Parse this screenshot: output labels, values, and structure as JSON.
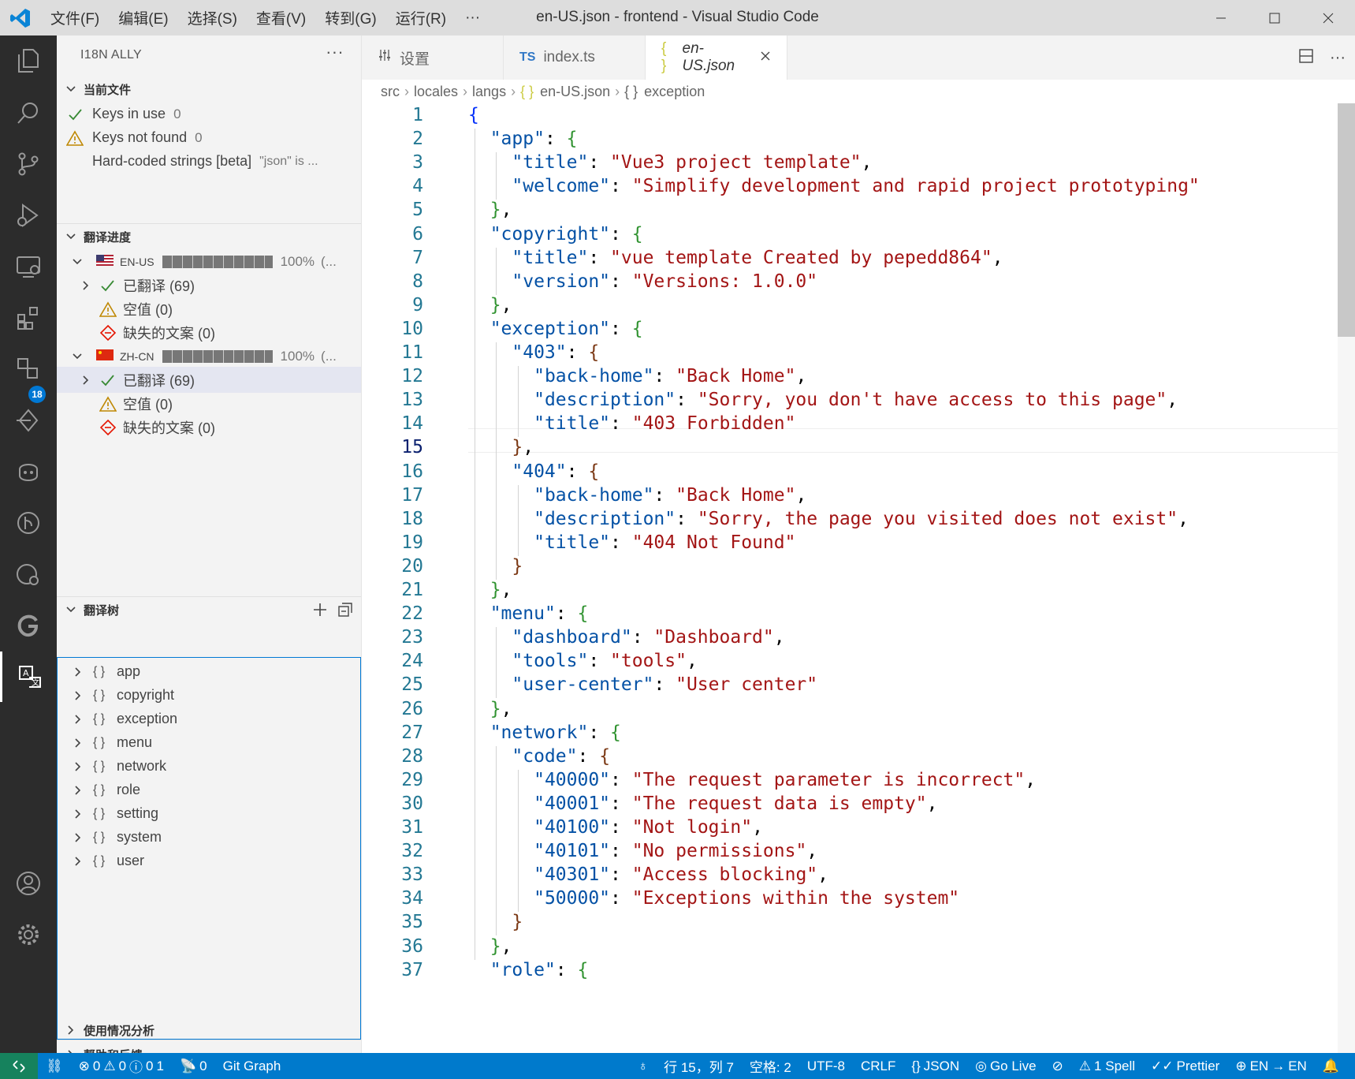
{
  "window": {
    "title": "en-US.json - frontend - Visual Studio Code",
    "menu": [
      "文件(F)",
      "编辑(E)",
      "选择(S)",
      "查看(V)",
      "转到(G)",
      "运行(R)",
      "···"
    ]
  },
  "activity_bar": {
    "icons": [
      "files-icon",
      "search-icon",
      "source-control-icon",
      "run-debug-icon",
      "remote-explorer-icon",
      "extensions-icon",
      "panel-icon",
      "timeline-icon",
      "copilot-icon",
      "git-graph-icon",
      "git-lens-icon",
      "gitlens-g-icon",
      "i18n-icon",
      "account-icon",
      "gear-icon"
    ],
    "extensions_badge": "18"
  },
  "sidebar": {
    "title": "I18N ALLY",
    "current_file": {
      "title": "当前文件",
      "keys_in_use": "Keys in use",
      "keys_in_use_count": "0",
      "keys_not_found": "Keys not found",
      "keys_not_found_count": "0",
      "hardcoded": "Hard-coded strings [beta]",
      "hardcoded_desc": "\"json\" is ..."
    },
    "progress": {
      "title": "翻译进度",
      "locales": [
        {
          "code": "EN-US",
          "percent": "100%",
          "extra": "(...",
          "translated": "已翻译 (69)",
          "empty": "空值 (0)",
          "missing": "缺失的文案 (0)"
        },
        {
          "code": "ZH-CN",
          "percent": "100%",
          "extra": "(...",
          "translated": "已翻译 (69)",
          "empty": "空值 (0)",
          "missing": "缺失的文案 (0)"
        }
      ]
    },
    "tree": {
      "title": "翻译树",
      "items": [
        "app",
        "copyright",
        "exception",
        "menu",
        "network",
        "role",
        "setting",
        "system",
        "user"
      ]
    },
    "usage": "使用情况分析",
    "help": "帮助和反馈"
  },
  "tabs": [
    {
      "icon": "settings",
      "label": "设置"
    },
    {
      "icon": "TS",
      "label": "index.ts"
    },
    {
      "icon": "{ }",
      "label": "en-US.json"
    }
  ],
  "breadcrumb": [
    "src",
    "locales",
    "langs",
    "en-US.json",
    "exception"
  ],
  "editor": {
    "current_line": "15",
    "lines": [
      {
        "n": "1",
        "parts": [
          [
            "b1",
            "{"
          ]
        ]
      },
      {
        "n": "2",
        "parts": [
          [
            "p",
            "  "
          ],
          [
            "k",
            "\"app\""
          ],
          [
            "p",
            ": "
          ],
          [
            "b2",
            "{"
          ]
        ]
      },
      {
        "n": "3",
        "parts": [
          [
            "p",
            "    "
          ],
          [
            "k",
            "\"title\""
          ],
          [
            "p",
            ": "
          ],
          [
            "s",
            "\"Vue3 project template\""
          ],
          [
            "p",
            ","
          ]
        ]
      },
      {
        "n": "4",
        "parts": [
          [
            "p",
            "    "
          ],
          [
            "k",
            "\"welcome\""
          ],
          [
            "p",
            ": "
          ],
          [
            "s",
            "\"Simplify development and rapid project prototyping\""
          ]
        ]
      },
      {
        "n": "5",
        "parts": [
          [
            "p",
            "  "
          ],
          [
            "b2",
            "}"
          ],
          [
            "p",
            ","
          ]
        ]
      },
      {
        "n": "6",
        "parts": [
          [
            "p",
            "  "
          ],
          [
            "k",
            "\"copyright\""
          ],
          [
            "p",
            ": "
          ],
          [
            "b2",
            "{"
          ]
        ]
      },
      {
        "n": "7",
        "parts": [
          [
            "p",
            "    "
          ],
          [
            "k",
            "\"title\""
          ],
          [
            "p",
            ": "
          ],
          [
            "s",
            "\"vue template Created by pepedd864\""
          ],
          [
            "p",
            ","
          ]
        ]
      },
      {
        "n": "8",
        "parts": [
          [
            "p",
            "    "
          ],
          [
            "k",
            "\"version\""
          ],
          [
            "p",
            ": "
          ],
          [
            "s",
            "\"Versions: 1.0.0\""
          ]
        ]
      },
      {
        "n": "9",
        "parts": [
          [
            "p",
            "  "
          ],
          [
            "b2",
            "}"
          ],
          [
            "p",
            ","
          ]
        ]
      },
      {
        "n": "10",
        "parts": [
          [
            "p",
            "  "
          ],
          [
            "k",
            "\"exception\""
          ],
          [
            "p",
            ": "
          ],
          [
            "b2",
            "{"
          ]
        ]
      },
      {
        "n": "11",
        "parts": [
          [
            "p",
            "    "
          ],
          [
            "k",
            "\"403\""
          ],
          [
            "p",
            ": "
          ],
          [
            "b3",
            "{"
          ]
        ]
      },
      {
        "n": "12",
        "parts": [
          [
            "p",
            "      "
          ],
          [
            "k",
            "\"back-home\""
          ],
          [
            "p",
            ": "
          ],
          [
            "s",
            "\"Back Home\""
          ],
          [
            "p",
            ","
          ]
        ]
      },
      {
        "n": "13",
        "parts": [
          [
            "p",
            "      "
          ],
          [
            "k",
            "\"description\""
          ],
          [
            "p",
            ": "
          ],
          [
            "s",
            "\"Sorry, you don't have access to this page\""
          ],
          [
            "p",
            ","
          ]
        ]
      },
      {
        "n": "14",
        "parts": [
          [
            "p",
            "      "
          ],
          [
            "k",
            "\"title\""
          ],
          [
            "p",
            ": "
          ],
          [
            "s",
            "\"403 Forbidden\""
          ]
        ]
      },
      {
        "n": "15",
        "parts": [
          [
            "p",
            "    "
          ],
          [
            "b3",
            "}"
          ],
          [
            "p",
            ","
          ]
        ]
      },
      {
        "n": "16",
        "parts": [
          [
            "p",
            "    "
          ],
          [
            "k",
            "\"404\""
          ],
          [
            "p",
            ": "
          ],
          [
            "b3",
            "{"
          ]
        ]
      },
      {
        "n": "17",
        "parts": [
          [
            "p",
            "      "
          ],
          [
            "k",
            "\"back-home\""
          ],
          [
            "p",
            ": "
          ],
          [
            "s",
            "\"Back Home\""
          ],
          [
            "p",
            ","
          ]
        ]
      },
      {
        "n": "18",
        "parts": [
          [
            "p",
            "      "
          ],
          [
            "k",
            "\"description\""
          ],
          [
            "p",
            ": "
          ],
          [
            "s",
            "\"Sorry, the page you visited does not exist\""
          ],
          [
            "p",
            ","
          ]
        ]
      },
      {
        "n": "19",
        "parts": [
          [
            "p",
            "      "
          ],
          [
            "k",
            "\"title\""
          ],
          [
            "p",
            ": "
          ],
          [
            "s",
            "\"404 Not Found\""
          ]
        ]
      },
      {
        "n": "20",
        "parts": [
          [
            "p",
            "    "
          ],
          [
            "b3",
            "}"
          ]
        ]
      },
      {
        "n": "21",
        "parts": [
          [
            "p",
            "  "
          ],
          [
            "b2",
            "}"
          ],
          [
            "p",
            ","
          ]
        ]
      },
      {
        "n": "22",
        "parts": [
          [
            "p",
            "  "
          ],
          [
            "k",
            "\"menu\""
          ],
          [
            "p",
            ": "
          ],
          [
            "b2",
            "{"
          ]
        ]
      },
      {
        "n": "23",
        "parts": [
          [
            "p",
            "    "
          ],
          [
            "k",
            "\"dashboard\""
          ],
          [
            "p",
            ": "
          ],
          [
            "s",
            "\"Dashboard\""
          ],
          [
            "p",
            ","
          ]
        ]
      },
      {
        "n": "24",
        "parts": [
          [
            "p",
            "    "
          ],
          [
            "k",
            "\"tools\""
          ],
          [
            "p",
            ": "
          ],
          [
            "s",
            "\"tools\""
          ],
          [
            "p",
            ","
          ]
        ]
      },
      {
        "n": "25",
        "parts": [
          [
            "p",
            "    "
          ],
          [
            "k",
            "\"user-center\""
          ],
          [
            "p",
            ": "
          ],
          [
            "s",
            "\"User center\""
          ]
        ]
      },
      {
        "n": "26",
        "parts": [
          [
            "p",
            "  "
          ],
          [
            "b2",
            "}"
          ],
          [
            "p",
            ","
          ]
        ]
      },
      {
        "n": "27",
        "parts": [
          [
            "p",
            "  "
          ],
          [
            "k",
            "\"network\""
          ],
          [
            "p",
            ": "
          ],
          [
            "b2",
            "{"
          ]
        ]
      },
      {
        "n": "28",
        "parts": [
          [
            "p",
            "    "
          ],
          [
            "k",
            "\"code\""
          ],
          [
            "p",
            ": "
          ],
          [
            "b3",
            "{"
          ]
        ]
      },
      {
        "n": "29",
        "parts": [
          [
            "p",
            "      "
          ],
          [
            "k",
            "\"40000\""
          ],
          [
            "p",
            ": "
          ],
          [
            "s",
            "\"The request parameter is incorrect\""
          ],
          [
            "p",
            ","
          ]
        ]
      },
      {
        "n": "30",
        "parts": [
          [
            "p",
            "      "
          ],
          [
            "k",
            "\"40001\""
          ],
          [
            "p",
            ": "
          ],
          [
            "s",
            "\"The request data is empty\""
          ],
          [
            "p",
            ","
          ]
        ]
      },
      {
        "n": "31",
        "parts": [
          [
            "p",
            "      "
          ],
          [
            "k",
            "\"40100\""
          ],
          [
            "p",
            ": "
          ],
          [
            "s",
            "\"Not login\""
          ],
          [
            "p",
            ","
          ]
        ]
      },
      {
        "n": "32",
        "parts": [
          [
            "p",
            "      "
          ],
          [
            "k",
            "\"40101\""
          ],
          [
            "p",
            ": "
          ],
          [
            "s",
            "\"No permissions\""
          ],
          [
            "p",
            ","
          ]
        ]
      },
      {
        "n": "33",
        "parts": [
          [
            "p",
            "      "
          ],
          [
            "k",
            "\"40301\""
          ],
          [
            "p",
            ": "
          ],
          [
            "s",
            "\"Access blocking\""
          ],
          [
            "p",
            ","
          ]
        ]
      },
      {
        "n": "34",
        "parts": [
          [
            "p",
            "      "
          ],
          [
            "k",
            "\"50000\""
          ],
          [
            "p",
            ": "
          ],
          [
            "s",
            "\"Exceptions within the system\""
          ]
        ]
      },
      {
        "n": "35",
        "parts": [
          [
            "p",
            "    "
          ],
          [
            "b3",
            "}"
          ]
        ]
      },
      {
        "n": "36",
        "parts": [
          [
            "p",
            "  "
          ],
          [
            "b2",
            "}"
          ],
          [
            "p",
            ","
          ]
        ]
      },
      {
        "n": "37",
        "parts": [
          [
            "p",
            "  "
          ],
          [
            "k",
            "\"role\""
          ],
          [
            "p",
            ": "
          ],
          [
            "b2",
            "{"
          ]
        ]
      }
    ]
  },
  "status": {
    "errors": "0",
    "warnings": "0",
    "info": "0",
    "info2": "1",
    "ports": "0",
    "git_graph": "Git Graph",
    "position": "行 15，列 7",
    "spaces": "空格: 2",
    "encoding": "UTF-8",
    "eol": "CRLF",
    "language": "JSON",
    "go_live": "Go Live",
    "spell": "1 Spell",
    "prettier": "Prettier",
    "locale": "EN",
    "locale2": "EN"
  },
  "colors": {
    "accent": "#007acc",
    "key": "#0451a5",
    "string": "#a31515"
  }
}
